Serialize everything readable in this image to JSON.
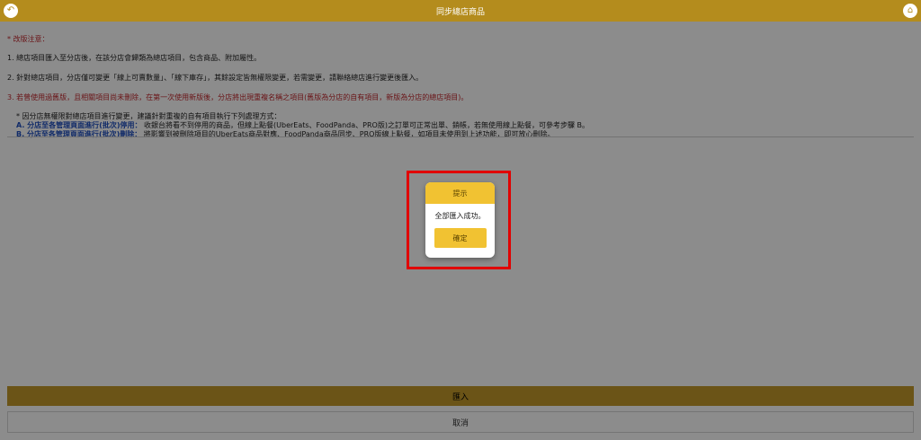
{
  "header": {
    "title": "同步總店商品",
    "back_icon": "↶",
    "home_icon": "⌂"
  },
  "notes": {
    "title": "* 改版注意：",
    "p1": "1. 總店項目匯入至分店後，在該分店會歸類為總店項目，包含商品、附加屬性。",
    "p2": "2. 針對總店項目，分店僅可變更「線上可賣數量」、「線下庫存」，其餘設定皆無權限變更，若需變更，請聯絡總店進行變更後匯入。",
    "p3": "3. 若曾使用過舊版，且相關項目尚未刪除，在第一次使用新版後，分店將出現重複名稱之項目(舊版為分店的自有項目，新版為分店的總店項目)。",
    "sub_intro": "* 因分店無權限對總店項目進行變更，建議針對重複的自有項目執行下列處理方式：",
    "sub_a_label": "A. 分店至各管理頁面進行(批次)停用：",
    "sub_a_text": "收銀台將看不到停用的商品，但線上點餐(UberEats、FoodPanda、PRO版)之訂單可正常出單、銷帳，若無使用線上點餐，可參考步驟 B。",
    "sub_b_label": "B. 分店至各管理頁面進行(批次)刪除：",
    "sub_b_text": "將影響到被刪除項目的UberEats商品對應、FoodPanda商品同步、PRO版線上點餐，如項目未使用到上述功能，即可放心刪除。"
  },
  "buttons": {
    "import": "匯入",
    "cancel": "取消"
  },
  "dialog": {
    "title": "提示",
    "message": "全部匯入成功。",
    "confirm": "確定"
  },
  "colors": {
    "brand": "#b48c1d",
    "accent": "#f1c232",
    "highlight": "#e10000",
    "note_red": "#c1272d",
    "note_blue": "#1f4fbf"
  }
}
